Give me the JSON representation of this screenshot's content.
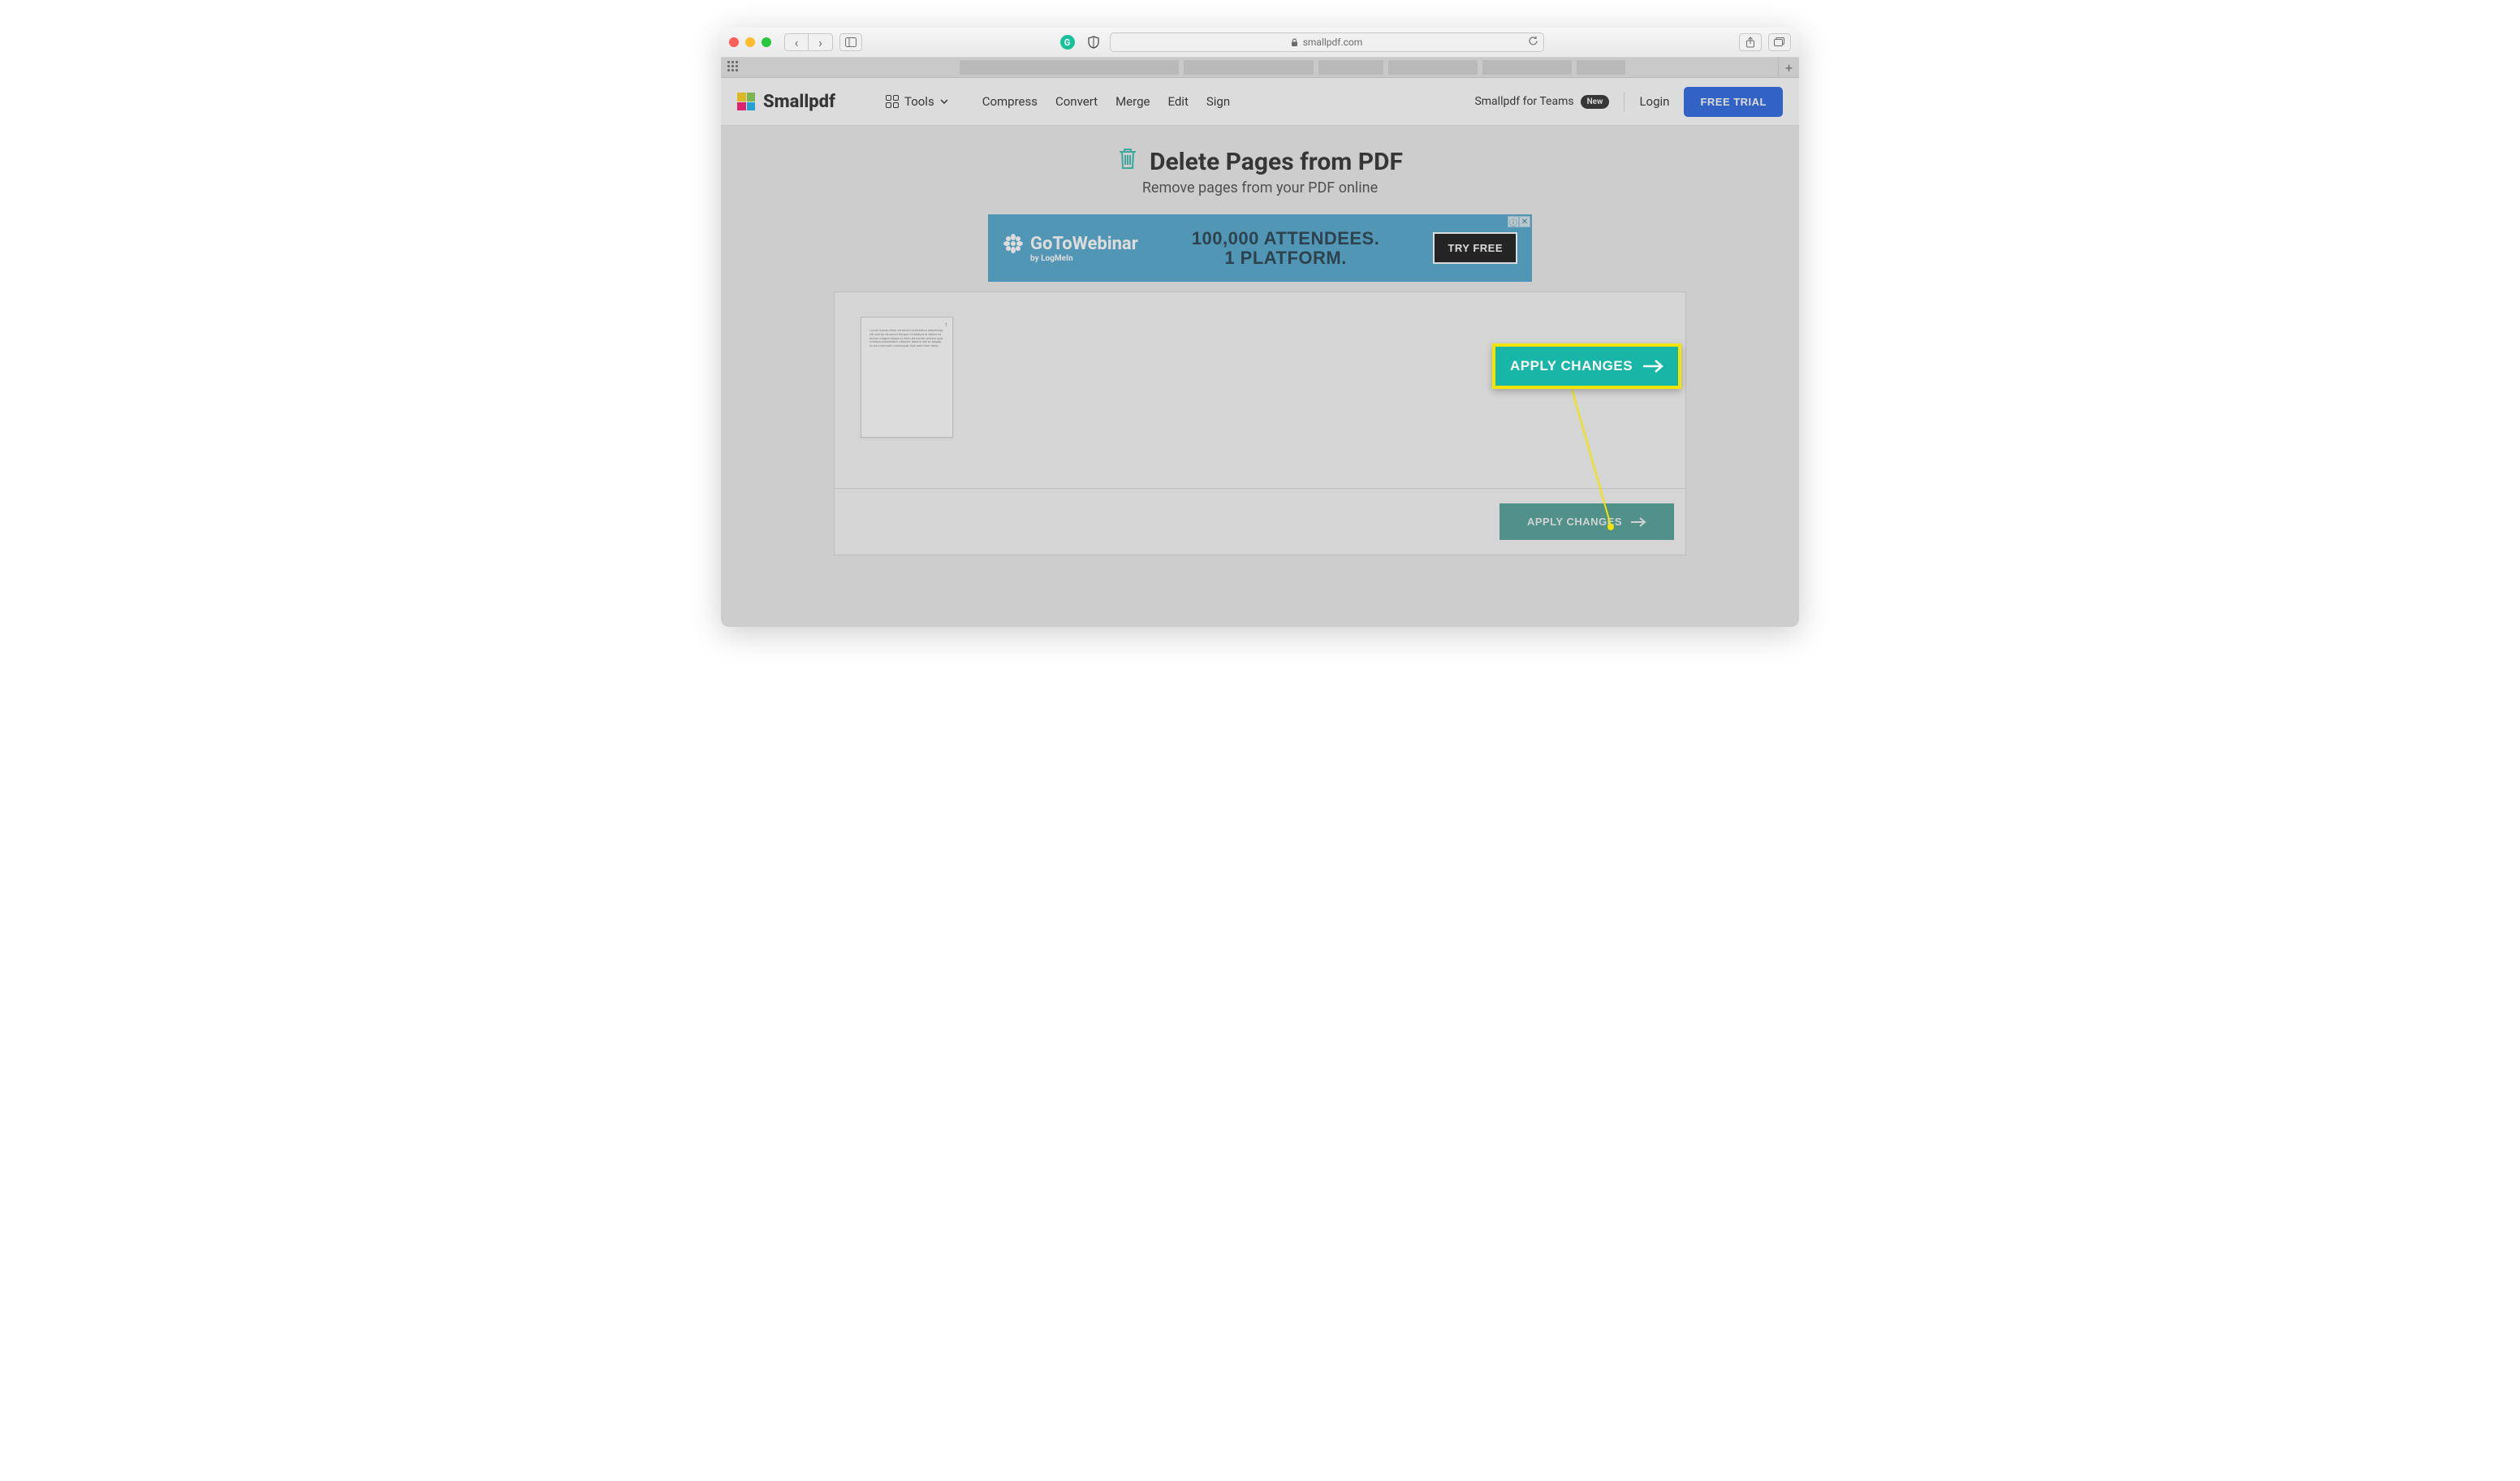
{
  "browser": {
    "url_display": "smallpdf.com",
    "back_icon": "‹",
    "fwd_icon": "›"
  },
  "header": {
    "brand": "Smallpdf",
    "tools_label": "Tools",
    "nav": {
      "compress": "Compress",
      "convert": "Convert",
      "merge": "Merge",
      "edit": "Edit",
      "sign": "Sign"
    },
    "teams_label": "Smallpdf for Teams",
    "badge_new": "New",
    "login": "Login",
    "trial": "FREE TRIAL"
  },
  "title": {
    "main": "Delete Pages from PDF",
    "sub": "Remove pages from your PDF online"
  },
  "ad": {
    "brand_top": "GoToWebinar",
    "brand_by": "by LogMeIn",
    "line1": "100,000 ATTENDEES.",
    "line2": "1 PLATFORM.",
    "cta": "TRY FREE",
    "info": "ⓘ",
    "close": "✕"
  },
  "workspace": {
    "page_number": "1",
    "apply_label": "APPLY CHANGES"
  },
  "callout": {
    "label": "APPLY CHANGES"
  }
}
